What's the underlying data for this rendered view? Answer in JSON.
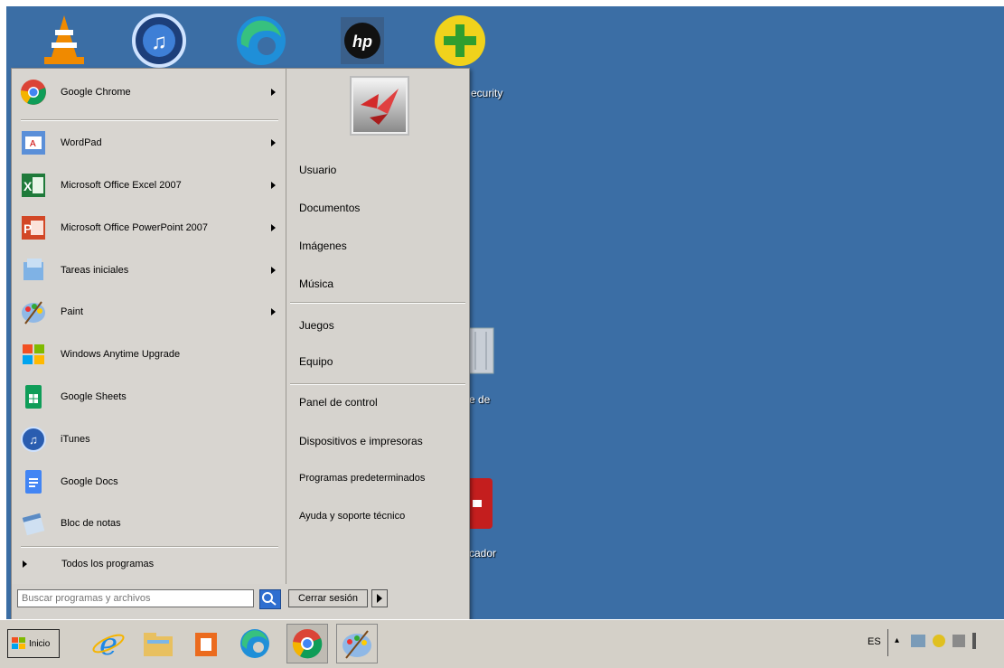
{
  "desktop": {
    "icons": [
      {
        "name": "vlc"
      },
      {
        "name": "itunes"
      },
      {
        "name": "edge"
      },
      {
        "name": "hp"
      },
      {
        "name": "security",
        "label": "ecurity"
      },
      {
        "name": "recycle-bin",
        "label": "e de"
      },
      {
        "name": "red-app",
        "label": "cador"
      }
    ]
  },
  "start_menu": {
    "programs": [
      {
        "label": "Google Chrome",
        "has_submenu": true
      },
      {
        "label": "WordPad",
        "has_submenu": true
      },
      {
        "label": "Microsoft Office Excel 2007",
        "has_submenu": true
      },
      {
        "label": "Microsoft Office PowerPoint 2007",
        "has_submenu": true
      },
      {
        "label": "Tareas iniciales",
        "has_submenu": true
      },
      {
        "label": "Paint",
        "has_submenu": true
      },
      {
        "label": "Windows Anytime Upgrade",
        "has_submenu": false
      },
      {
        "label": "Google Sheets",
        "has_submenu": false
      },
      {
        "label": "iTunes",
        "has_submenu": false
      },
      {
        "label": "Google Docs",
        "has_submenu": false
      },
      {
        "label": "Bloc de notas",
        "has_submenu": false
      }
    ],
    "all_programs": "Todos los programas",
    "right_links": [
      "Usuario",
      "Documentos",
      "Imágenes",
      "Música",
      "Juegos",
      "Equipo",
      "Panel de control",
      "Dispositivos e impresoras",
      "Programas predeterminados",
      "Ayuda y soporte técnico"
    ],
    "search_placeholder": "Buscar programas y archivos",
    "shutdown_label": "Cerrar sesión"
  },
  "taskbar": {
    "start_label": "Inicio",
    "pinned": [
      "internet-explorer",
      "file-explorer",
      "office",
      "edge",
      "chrome",
      "paint"
    ],
    "tray_lang": "ES"
  }
}
